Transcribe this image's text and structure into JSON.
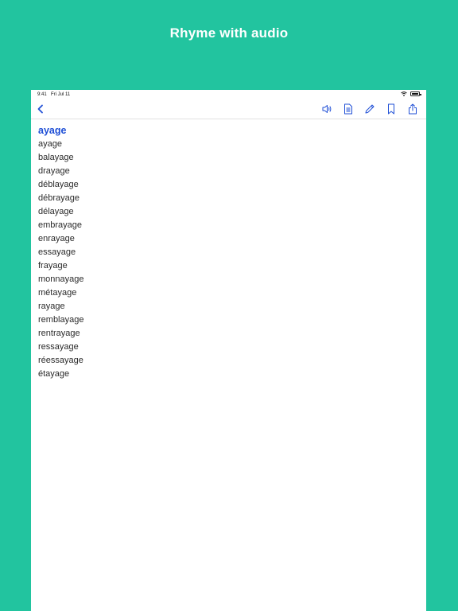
{
  "promo": {
    "title": "Rhyme with audio"
  },
  "status_bar": {
    "time": "9:41",
    "date": "Fri Jul 11"
  },
  "toolbar": {
    "icons": [
      "chevron-left-icon",
      "speaker-icon",
      "document-icon",
      "pencil-icon",
      "bookmark-icon",
      "share-icon"
    ]
  },
  "colors": {
    "background": "#22c49f",
    "accent": "#1f4fd6"
  },
  "content": {
    "heading": "ayage",
    "rhymes": [
      "ayage",
      "balayage",
      "drayage",
      "déblayage",
      "débrayage",
      "délayage",
      "embrayage",
      "enrayage",
      "essayage",
      "frayage",
      "monnayage",
      "métayage",
      "rayage",
      "remblayage",
      "rentrayage",
      "ressayage",
      "réessayage",
      "étayage"
    ]
  }
}
